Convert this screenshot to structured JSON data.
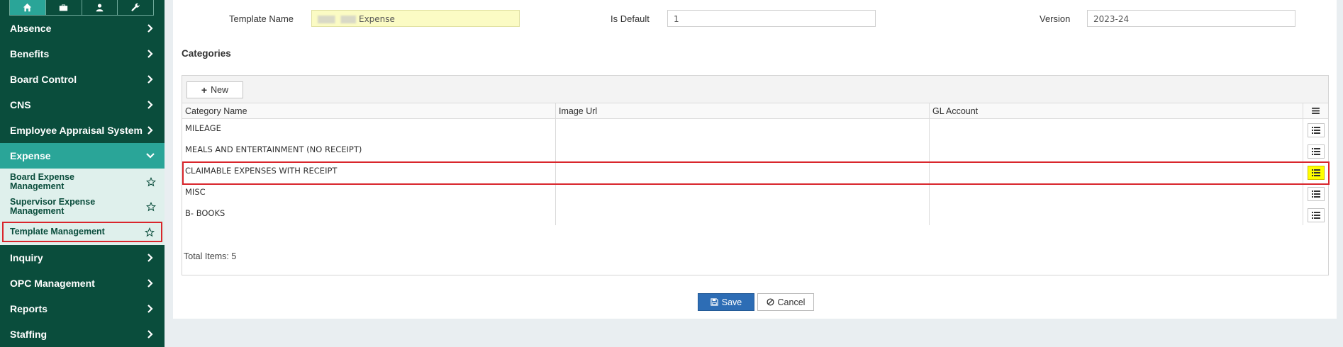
{
  "sidebar": {
    "top_tabs": [
      {
        "icon": "home-icon"
      },
      {
        "icon": "briefcase-icon"
      },
      {
        "icon": "user-icon"
      },
      {
        "icon": "wrench-icon"
      }
    ],
    "items": [
      {
        "label": "Absence"
      },
      {
        "label": "Benefits"
      },
      {
        "label": "Board Control"
      },
      {
        "label": "CNS"
      },
      {
        "label": "Employee Appraisal System"
      },
      {
        "label": "Expense"
      },
      {
        "label": "Inquiry"
      },
      {
        "label": "OPC Management"
      },
      {
        "label": "Reports"
      },
      {
        "label": "Staffing"
      }
    ],
    "expense_sub": [
      {
        "label": "Board Expense Management"
      },
      {
        "label": "Supervisor Expense Management"
      },
      {
        "label": "Template Management"
      }
    ]
  },
  "form": {
    "template_name_label": "Template Name",
    "template_name_value": "Expense",
    "is_default_label": "Is Default",
    "is_default_value": "1",
    "version_label": "Version",
    "version_value": "2023-24"
  },
  "categories": {
    "title": "Categories",
    "new_button": "New",
    "columns": [
      "Category Name",
      "Image Url",
      "GL Account"
    ],
    "rows": [
      {
        "name": "MILEAGE",
        "image_url": "",
        "gl_account": ""
      },
      {
        "name": "MEALS AND ENTERTAINMENT (NO RECEIPT)",
        "image_url": "",
        "gl_account": ""
      },
      {
        "name": "CLAIMABLE EXPENSES WITH RECEIPT",
        "image_url": "",
        "gl_account": ""
      },
      {
        "name": "MISC",
        "image_url": "",
        "gl_account": ""
      },
      {
        "name": "B- BOOKS",
        "image_url": "",
        "gl_account": ""
      }
    ],
    "total_label": "Total Items: 5"
  },
  "actions": {
    "save": "Save",
    "cancel": "Cancel"
  },
  "colors": {
    "sidebar_bg": "#0a4d3c",
    "sidebar_active": "#2aa598",
    "highlight_red": "#d9262c",
    "highlight_yellow": "#ffff00",
    "save_blue": "#2d6db5"
  }
}
